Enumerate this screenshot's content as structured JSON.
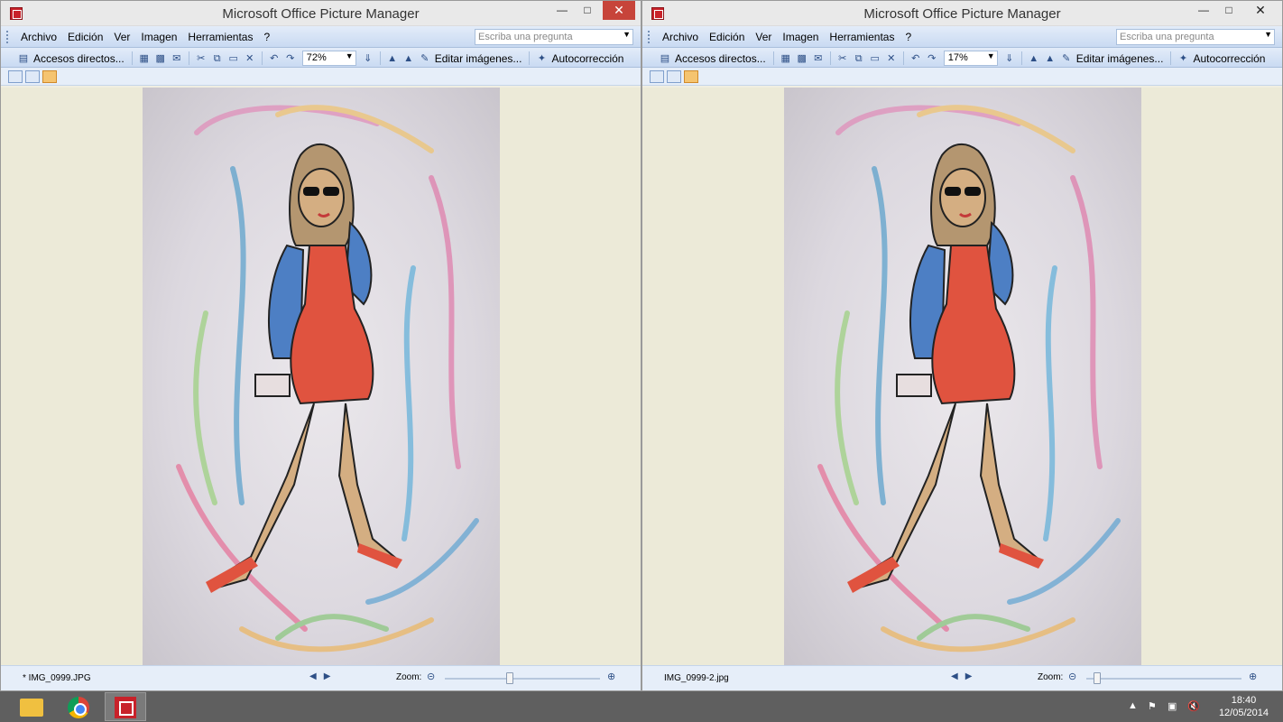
{
  "windows": [
    {
      "title": "Microsoft Office Picture Manager",
      "menu": [
        "Archivo",
        "Edición",
        "Ver",
        "Imagen",
        "Herramientas",
        "?"
      ],
      "ask_placeholder": "Escriba una pregunta",
      "toolbar": {
        "shortcuts_label": "Accesos directos...",
        "zoom_value": "72%",
        "edit_label": "Editar imágenes...",
        "autocorrect_label": "Autocorrección"
      },
      "status": {
        "filename": "* IMG_0999.JPG",
        "zoom_label": "Zoom:"
      },
      "zoom_level": 0.72
    },
    {
      "title": "Microsoft Office Picture Manager",
      "menu": [
        "Archivo",
        "Edición",
        "Ver",
        "Imagen",
        "Herramientas",
        "?"
      ],
      "ask_placeholder": "Escriba una pregunta",
      "toolbar": {
        "shortcuts_label": "Accesos directos...",
        "zoom_value": "17%",
        "edit_label": "Editar imágenes...",
        "autocorrect_label": "Autocorrección"
      },
      "status": {
        "filename": "IMG_0999-2.jpg",
        "zoom_label": "Zoom:"
      },
      "zoom_level": 0.17
    }
  ],
  "taskbar": {
    "time": "18:40",
    "date": "12/05/2014"
  },
  "icons": [
    "app-icon",
    "save-icon",
    "print-icon",
    "cut-icon",
    "copy-icon",
    "paste-icon",
    "delete-icon",
    "undo-icon",
    "redo-icon",
    "rotate-left-icon",
    "rotate-right-icon",
    "edit-pictures-icon",
    "autocorrect-icon",
    "thumbnail-view-icon",
    "filmstrip-view-icon",
    "single-picture-view-icon",
    "previous-icon",
    "next-icon",
    "zoom-out-icon",
    "zoom-in-icon"
  ],
  "colors": {
    "title_bar": "#e9e9e9",
    "toolbar": "#c9daf2",
    "close_button": "#c7443a",
    "canvas": "#ecead8",
    "taskbar": "#5f5f5f"
  }
}
